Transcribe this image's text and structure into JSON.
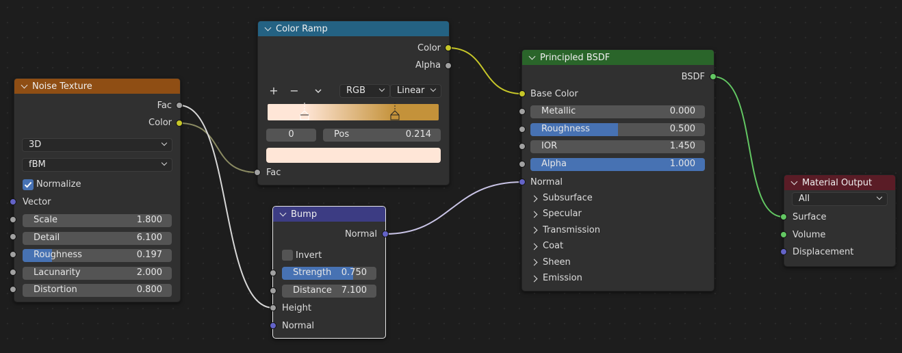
{
  "colors": {
    "background": "#1d1d1d",
    "node_body": "#303030",
    "texture_header": "#8f4e14",
    "converter_header": "#246283",
    "shader_header": "#2a652a",
    "vector_header": "#3c3c83",
    "output_header": "#5a1c26",
    "socket_gray": "#a1a1a1",
    "socket_yellow": "#c7c729",
    "socket_purple": "#6363c7",
    "socket_green": "#63c763",
    "slider_fill": "#4772b3",
    "ramp_left": "#ffe6d7",
    "ramp_right": "#c4923a"
  },
  "noise_texture": {
    "title": "Noise Texture",
    "out_fac": "Fac",
    "out_color": "Color",
    "dimension": "3D",
    "type": "fBM",
    "normalize_label": "Normalize",
    "normalize_checked": true,
    "vector_label": "Vector",
    "fields": [
      {
        "name": "Scale",
        "value": "1.800",
        "fill": 0
      },
      {
        "name": "Detail",
        "value": "6.100",
        "fill": 0
      },
      {
        "name": "Roughness",
        "value": "0.197",
        "fill": 0.197
      },
      {
        "name": "Lacunarity",
        "value": "2.000",
        "fill": 0
      },
      {
        "name": "Distortion",
        "value": "0.800",
        "fill": 0
      }
    ]
  },
  "color_ramp": {
    "title": "Color Ramp",
    "out_color": "Color",
    "out_alpha": "Alpha",
    "add_icon": "plus-icon",
    "remove_icon": "minus-icon",
    "menu_icon": "chevron-down-icon",
    "color_mode": "RGB",
    "interpolation": "Linear",
    "active_index": "0",
    "pos_label": "Pos",
    "pos_value": "0.214",
    "stops": [
      0.214,
      0.745
    ],
    "selected_color": "#ffe6d7",
    "in_fac": "Fac"
  },
  "bump": {
    "title": "Bump",
    "out_normal": "Normal",
    "invert_label": "Invert",
    "invert_checked": false,
    "fields": [
      {
        "name": "Strength",
        "value": "0.750",
        "fill": 0.75
      },
      {
        "name": "Distance",
        "value": "7.100",
        "fill": 0
      }
    ],
    "in_height": "Height",
    "in_normal": "Normal"
  },
  "principled": {
    "title": "Principled BSDF",
    "out_bsdf": "BSDF",
    "base_color": "Base Color",
    "fields": [
      {
        "name": "Metallic",
        "value": "0.000",
        "fill": 0
      },
      {
        "name": "Roughness",
        "value": "0.500",
        "fill": 0.5
      },
      {
        "name": "IOR",
        "value": "1.450",
        "fill": 0
      },
      {
        "name": "Alpha",
        "value": "1.000",
        "fill": 1
      }
    ],
    "normal": "Normal",
    "panels": [
      "Subsurface",
      "Specular",
      "Transmission",
      "Coat",
      "Sheen",
      "Emission"
    ]
  },
  "material_output": {
    "title": "Material Output",
    "target": "All",
    "in_surface": "Surface",
    "in_volume": "Volume",
    "in_displacement": "Displacement"
  }
}
